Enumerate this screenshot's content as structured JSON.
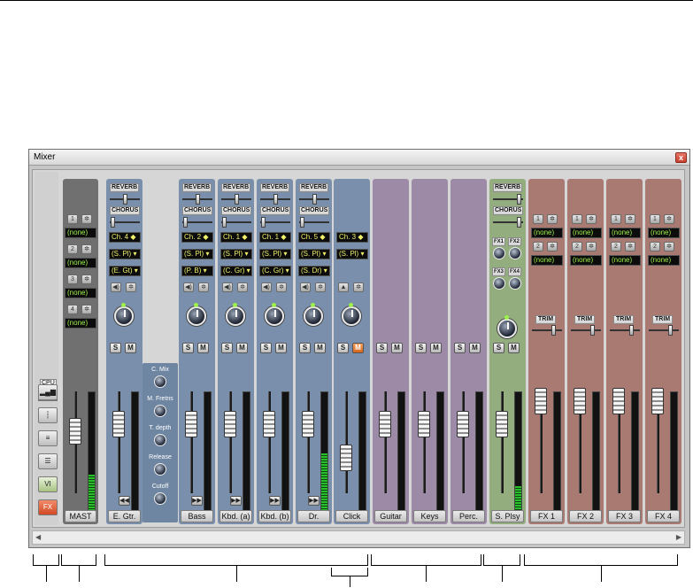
{
  "window": {
    "title": "Mixer",
    "close_glyph": "x"
  },
  "tools": {
    "cpu_label": "CPU",
    "cpu_value": "—",
    "buttons": [
      {
        "name": "meter-bars-icon",
        "glyph": "▂▄▆"
      },
      {
        "name": "insert-icon",
        "glyph": "┆"
      },
      {
        "name": "list-icon",
        "glyph": "≡"
      },
      {
        "name": "menu-icon",
        "glyph": "☰"
      },
      {
        "name": "vi-button",
        "glyph": "VI"
      },
      {
        "name": "fx-button",
        "glyph": "FX"
      }
    ]
  },
  "labels": {
    "reverb": "REVERB",
    "chorus": "CHORUS",
    "solo": "S",
    "mute": "M",
    "trim": "TRIM",
    "fx1": "FX1",
    "fx2": "FX2",
    "fx3": "FX3",
    "fx4": "FX4"
  },
  "master": {
    "name": "MAST",
    "sends": [
      {
        "num": "1",
        "value": "(none)"
      },
      {
        "num": "2",
        "value": "(none)"
      },
      {
        "num": "3",
        "value": "(none)"
      },
      {
        "num": "4",
        "value": "(none)"
      }
    ]
  },
  "plugin_panel": {
    "params": [
      "C. Mix",
      "M. Fretns",
      "T. depth",
      "Release",
      "Cutoff"
    ]
  },
  "channels": [
    {
      "name": "E. Gtr.",
      "ch": "Ch. 4",
      "port": "(S. Pl)",
      "inst": "(E. Gt)",
      "color": "#7a8fab",
      "meter": 0,
      "solo_on": false,
      "mute_on": false
    },
    {
      "name": "Bass",
      "ch": "Ch. 2",
      "port": "(S. Pl)",
      "inst": "(P. B)",
      "color": "#7a8fab",
      "meter": 0,
      "solo_on": false,
      "mute_on": false
    },
    {
      "name": "Kbd. (a)",
      "ch": "Ch. 1",
      "port": "(S. Pl)",
      "inst": "(C. Gr)",
      "color": "#7a8fab",
      "meter": 0,
      "solo_on": false,
      "mute_on": false
    },
    {
      "name": "Kbd. (b)",
      "ch": "Ch. 1",
      "port": "(S. Pl)",
      "inst": "(C. Gr)",
      "color": "#7a8fab",
      "meter": 0,
      "solo_on": false,
      "mute_on": false
    },
    {
      "name": "Dr.",
      "ch": "Ch. 5",
      "port": "(S. Pl)",
      "inst": "(S. Dr)",
      "color": "#7a8fab",
      "meter": 0.48,
      "solo_on": false,
      "mute_on": false
    },
    {
      "name": "Click",
      "ch": "Ch. 3",
      "port": "(S. Pl)",
      "inst": "",
      "color": "#7a8fab",
      "meter": 0,
      "solo_on": false,
      "mute_on": true
    }
  ],
  "audio_channels": [
    {
      "name": "Guitar",
      "color": "#9c8aa6"
    },
    {
      "name": "Keys",
      "color": "#9c8aa6"
    },
    {
      "name": "Perc.",
      "color": "#9c8aa6"
    }
  ],
  "sound_player": {
    "name": "S. Plsy",
    "color": "#93ad7e",
    "meter": 0.2
  },
  "fx_buses": [
    {
      "name": "FX 1",
      "send1": "(none)",
      "send2": "(none)"
    },
    {
      "name": "FX 2",
      "send1": "(none)",
      "send2": "(none)"
    },
    {
      "name": "FX 3",
      "send1": "(none)",
      "send2": "(none)"
    },
    {
      "name": "FX 4",
      "send1": "(none)",
      "send2": "(none)"
    }
  ],
  "colors": {
    "midi": "#7a8fab",
    "audio": "#9c8aa6",
    "sound_player": "#93ad7e",
    "fx": "#a97a72",
    "master": "#707070"
  }
}
